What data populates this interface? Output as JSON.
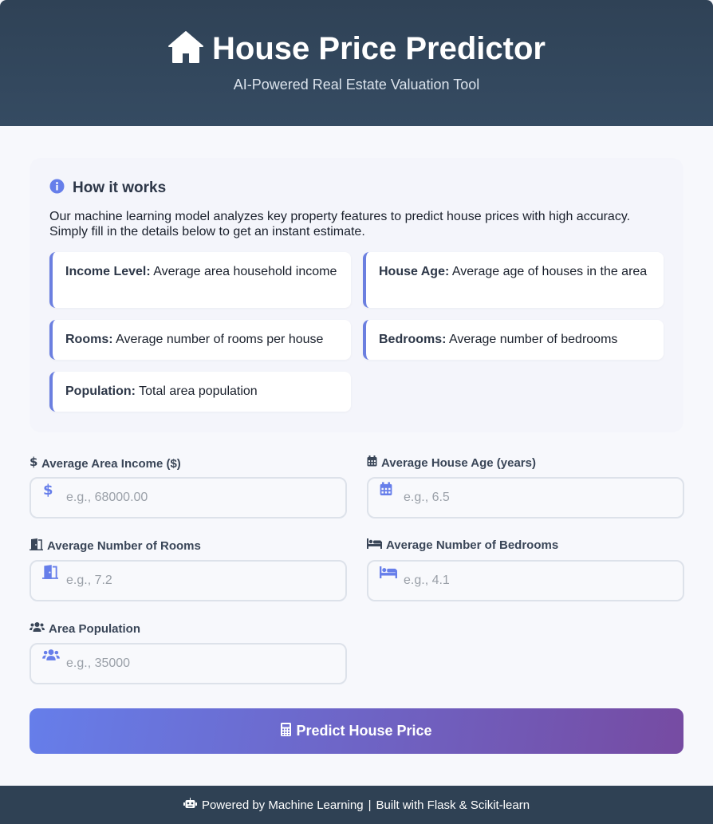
{
  "header": {
    "title": "House Price Predictor",
    "subtitle": "AI-Powered Real Estate Valuation Tool",
    "icon": "house-icon"
  },
  "info": {
    "heading": "How it works",
    "icon": "info-circle-icon",
    "description": "Our machine learning model analyzes key property features to predict house prices with high accuracy. Simply fill in the details below to get an instant estimate.",
    "features": [
      {
        "name": "Income Level:",
        "desc": "Average area household income"
      },
      {
        "name": "House Age:",
        "desc": "Average age of houses in the area"
      },
      {
        "name": "Rooms:",
        "desc": "Average number of rooms per house"
      },
      {
        "name": "Bedrooms:",
        "desc": "Average number of bedrooms"
      },
      {
        "name": "Population:",
        "desc": "Total area population"
      }
    ]
  },
  "form": {
    "income": {
      "label": "Average Area Income ($)",
      "placeholder": "e.g., 68000.00",
      "value": "",
      "icon": "dollar-icon"
    },
    "age": {
      "label": "Average House Age (years)",
      "placeholder": "e.g., 6.5",
      "value": "",
      "icon": "calendar-icon"
    },
    "rooms": {
      "label": "Average Number of Rooms",
      "placeholder": "e.g., 7.2",
      "value": "",
      "icon": "door-icon"
    },
    "bedrooms": {
      "label": "Average Number of Bedrooms",
      "placeholder": "e.g., 4.1",
      "value": "",
      "icon": "bed-icon"
    },
    "population": {
      "label": "Area Population",
      "placeholder": "e.g., 35000",
      "value": "",
      "icon": "users-icon"
    },
    "submit_label": "Predict House Price",
    "submit_icon": "calculator-icon"
  },
  "footer": {
    "text": "Powered by Machine Learning",
    "separator": "|",
    "text2": "Built with Flask & Scikit-learn",
    "icon": "robot-icon"
  },
  "colors": {
    "header_bg": "#344a60",
    "accent": "#667eea",
    "accent_end": "#764ba2",
    "footer_bg": "#2f4154"
  }
}
